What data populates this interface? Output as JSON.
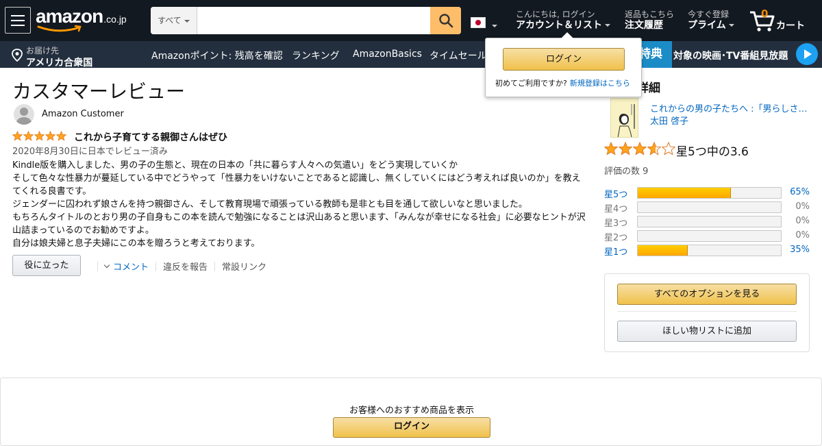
{
  "colors": {
    "nav_bg": "#131921",
    "subnav_bg": "#232f3e",
    "accent": "#febd69",
    "link": "#0066c0",
    "star": "#ffa41c",
    "cart_count": "#f08804"
  },
  "header": {
    "logo_word": "amazon",
    "logo_tld": ".co.jp",
    "search": {
      "category": "すべて",
      "placeholder": "",
      "value": ""
    },
    "account": {
      "line1": "こんにちは, ログイン",
      "line2": "アカウント＆リスト"
    },
    "orders": {
      "line1": "返品もこちら",
      "line2": "注文履歴"
    },
    "prime": {
      "line1": "今すぐ登録",
      "line2": "プライム"
    },
    "cart": {
      "count": "0",
      "label": "カート"
    }
  },
  "subnav": {
    "deliver": {
      "line1": "お届け先",
      "line2": "アメリカ合衆国"
    },
    "links": [
      "Amazonポイント: 残高を確認",
      "ランキング",
      "AmazonBasics",
      "タイムセール"
    ],
    "promo": {
      "tag": "特典",
      "text": "対象の映画･TV番組見放題"
    }
  },
  "flyout": {
    "login": "ログイン",
    "new_prompt": "初めてご利用ですか?",
    "new_link": "新規登録はこちら"
  },
  "review": {
    "page_title": "カスタマーレビュー",
    "reviewer": "Amazon Customer",
    "stars": 5,
    "title": "これから子育てする親御さんはぜひ",
    "date": "2020年8月30日に日本でレビュー済み",
    "body": [
      "Kindle版を購入しました、男の子の生態と、現在の日本の「共に暮らす人々への気遣い」をどう実現していくか",
      "そして色々な性暴力が蔓延している中でどうやって「性暴力をいけないことであると認識し、無くしていくにはどう考えれば良いのか」を教えてくれる良書です。",
      "ジェンダーに囚われず娘さんを持つ親御さん、そして教育現場で頑張っている教師も是非とも目を通して欲しいなと思いました。",
      "もちろんタイトルのとおり男の子自身もこの本を読んで勉強になることは沢山あると思います、「みんなが幸せになる社会」に必要なヒントが沢山詰まっているのでお勧めですよ。",
      "自分は娘夫婦と息子夫婦にこの本を贈ろうと考えております。"
    ],
    "helpful_button": "役に立った",
    "comment": "コメント",
    "report": "違反を報告",
    "permalink": "常設リンク"
  },
  "product": {
    "section_title": "詳細",
    "name": "これからの男の子たちへ :「男らしさ」から自由になるためのレッスン",
    "author": "太田 啓子",
    "rating_value": 3.6,
    "rating_text": "星5つ中の3.6",
    "count_text": "評価の数 9",
    "histogram": [
      {
        "label": "星5つ",
        "percent": 65,
        "percent_text": "65%"
      },
      {
        "label": "星4つ",
        "percent": 0,
        "percent_text": "0%"
      },
      {
        "label": "星3つ",
        "percent": 0,
        "percent_text": "0%"
      },
      {
        "label": "星2つ",
        "percent": 0,
        "percent_text": "0%"
      },
      {
        "label": "星1つ",
        "percent": 35,
        "percent_text": "35%"
      }
    ],
    "options_button": "すべてのオプションを見る",
    "wishlist_button": "ほしい物リストに追加"
  },
  "reco": {
    "text": "お客様へのおすすめ商品を表示",
    "login": "ログイン"
  }
}
